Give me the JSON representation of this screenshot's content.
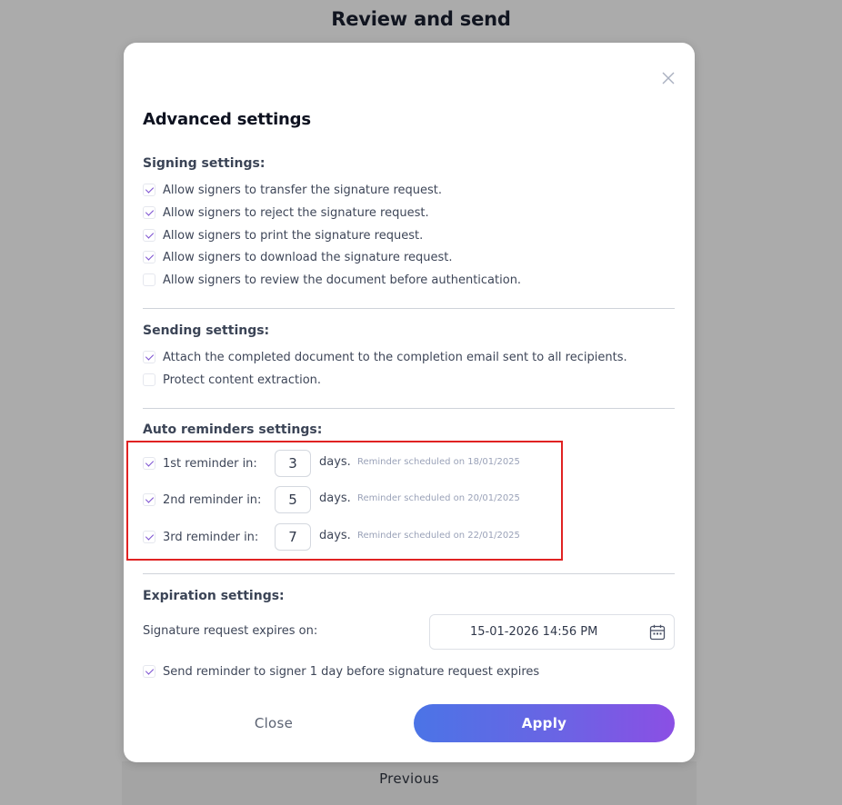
{
  "page": {
    "title": "Review and send",
    "previous_label": "Previous"
  },
  "modal": {
    "title": "Advanced settings",
    "close_icon": "close-icon",
    "signing": {
      "title": "Signing settings:",
      "options": [
        {
          "label": "Allow signers to transfer the signature request.",
          "checked": true
        },
        {
          "label": "Allow signers to reject the signature request.",
          "checked": true
        },
        {
          "label": "Allow signers to print the signature request.",
          "checked": true
        },
        {
          "label": "Allow signers to download the signature request.",
          "checked": true
        },
        {
          "label": "Allow signers to review the document before authentication.",
          "checked": false
        }
      ]
    },
    "sending": {
      "title": "Sending settings:",
      "options": [
        {
          "label": "Attach the completed document to the completion email sent to all recipients.",
          "checked": true
        },
        {
          "label": "Protect content extraction.",
          "checked": false
        }
      ]
    },
    "reminders": {
      "title": "Auto reminders settings:",
      "days_label": "days.",
      "items": [
        {
          "label": "1st reminder in:",
          "days": "3",
          "scheduled": "Reminder scheduled on 18/01/2025",
          "checked": true
        },
        {
          "label": "2nd reminder in:",
          "days": "5",
          "scheduled": "Reminder scheduled on 20/01/2025",
          "checked": true
        },
        {
          "label": "3rd reminder in:",
          "days": "7",
          "scheduled": "Reminder scheduled on 22/01/2025",
          "checked": true
        }
      ]
    },
    "expiration": {
      "title": "Expiration settings:",
      "expires_label": "Signature request expires on:",
      "expires_value": "15-01-2026 14:56 PM",
      "calendar_icon": "calendar-icon",
      "reminder_option": {
        "label": "Send reminder to signer 1 day before signature request expires",
        "checked": true
      }
    },
    "buttons": {
      "close_label": "Close",
      "apply_label": "Apply"
    }
  },
  "colors": {
    "overlay": "#ababab",
    "accent_start": "#4b74e6",
    "accent_end": "#8b4fe4",
    "check": "#7a4fd0",
    "highlight": "#e02222"
  }
}
